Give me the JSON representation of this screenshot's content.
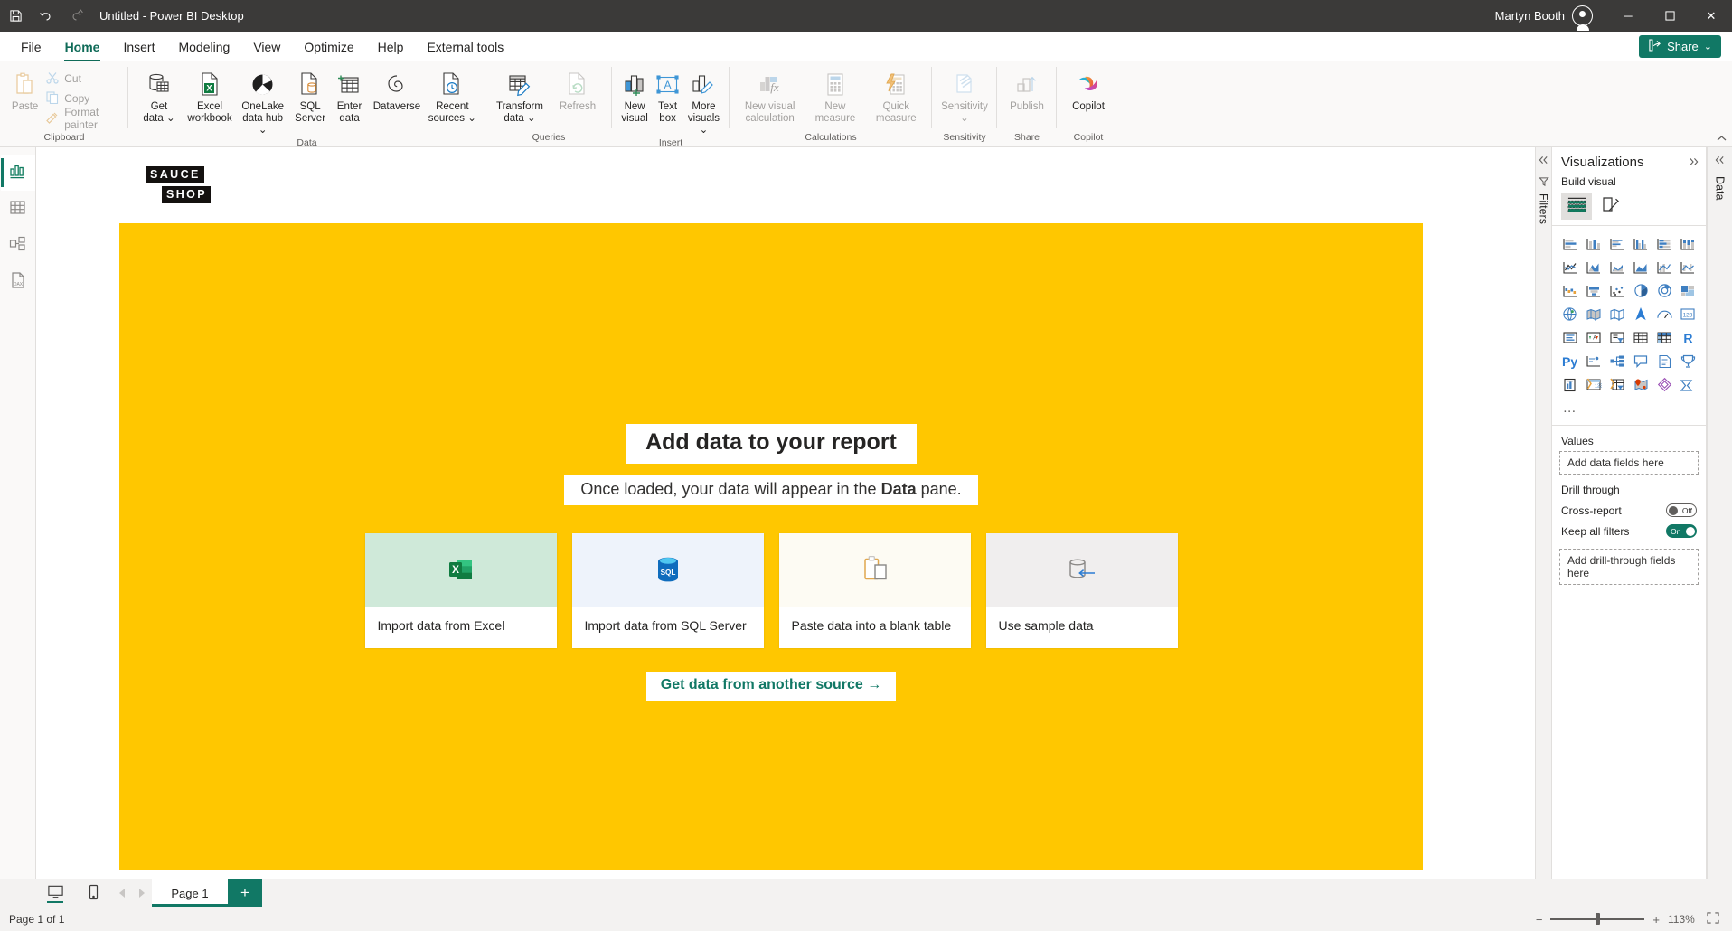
{
  "titlebar": {
    "save_icon": "save-icon",
    "undo_icon": "undo-icon",
    "redo_icon": "redo-icon",
    "title": "Untitled - Power BI Desktop",
    "user_name": "Martyn Booth",
    "avatar_icon": "account-avatar-icon",
    "minimize": "─",
    "maximize": "☐",
    "close": "✕"
  },
  "ribbon_tabs": [
    {
      "label": "File",
      "active": false
    },
    {
      "label": "Home",
      "active": true
    },
    {
      "label": "Insert",
      "active": false
    },
    {
      "label": "Modeling",
      "active": false
    },
    {
      "label": "View",
      "active": false
    },
    {
      "label": "Optimize",
      "active": false
    },
    {
      "label": "Help",
      "active": false
    },
    {
      "label": "External tools",
      "active": false
    }
  ],
  "share_button": {
    "label": "Share",
    "chevron": "⌄",
    "color": "#117865"
  },
  "ribbon": {
    "collapse_icon": "chevron-up-icon",
    "groups": [
      {
        "name": "clipboard",
        "label": "Clipboard",
        "paste": {
          "label": "Paste",
          "icon": "paste-icon",
          "disabled": true
        },
        "items": [
          {
            "label": "Cut",
            "icon": "scissors-icon",
            "disabled": true
          },
          {
            "label": "Copy",
            "icon": "copy-icon",
            "disabled": true
          },
          {
            "label": "Format painter",
            "icon": "format-painter-icon",
            "disabled": true
          }
        ]
      },
      {
        "name": "data",
        "label": "Data",
        "items": [
          {
            "label": "Get\ndata",
            "line1": "Get",
            "line2": "data ⌄",
            "icon": "get-data-icon",
            "disabled": false
          },
          {
            "label": "Excel workbook",
            "line1": "Excel",
            "line2": "workbook",
            "icon": "excel-icon",
            "disabled": false
          },
          {
            "label": "OneLake data hub",
            "line1": "OneLake",
            "line2": "data hub ⌄",
            "icon": "onelake-icon",
            "disabled": false
          },
          {
            "label": "SQL Server",
            "line1": "SQL",
            "line2": "Server",
            "icon": "sql-server-icon",
            "disabled": false
          },
          {
            "label": "Enter data",
            "line1": "Enter",
            "line2": "data",
            "icon": "enter-data-icon",
            "disabled": false
          },
          {
            "label": "Dataverse",
            "line1": "Dataverse",
            "line2": "",
            "icon": "dataverse-icon",
            "disabled": false
          },
          {
            "label": "Recent sources",
            "line1": "Recent",
            "line2": "sources ⌄",
            "icon": "recent-sources-icon",
            "disabled": false
          }
        ]
      },
      {
        "name": "queries",
        "label": "Queries",
        "items": [
          {
            "line1": "Transform",
            "line2": "data ⌄",
            "icon": "transform-data-icon",
            "disabled": false
          },
          {
            "line1": "Refresh",
            "line2": "",
            "icon": "refresh-icon",
            "disabled": true
          }
        ]
      },
      {
        "name": "insert",
        "label": "Insert",
        "items": [
          {
            "line1": "New",
            "line2": "visual",
            "icon": "new-visual-icon",
            "disabled": false
          },
          {
            "line1": "Text",
            "line2": "box",
            "icon": "text-box-icon",
            "disabled": false
          },
          {
            "line1": "More",
            "line2": "visuals ⌄",
            "icon": "more-visuals-icon",
            "disabled": false
          }
        ]
      },
      {
        "name": "calculations",
        "label": "Calculations",
        "items": [
          {
            "line1": "New visual",
            "line2": "calculation",
            "icon": "new-visual-calculation-icon",
            "disabled": true
          },
          {
            "line1": "New",
            "line2": "measure",
            "icon": "new-measure-icon",
            "disabled": true
          },
          {
            "line1": "Quick",
            "line2": "measure",
            "icon": "quick-measure-icon",
            "disabled": true
          }
        ]
      },
      {
        "name": "sensitivity",
        "label": "Sensitivity",
        "items": [
          {
            "line1": "Sensitivity",
            "line2": "⌄",
            "icon": "sensitivity-icon",
            "disabled": true
          }
        ]
      },
      {
        "name": "share",
        "label": "Share",
        "items": [
          {
            "line1": "Publish",
            "line2": "",
            "icon": "publish-icon",
            "disabled": true
          }
        ]
      },
      {
        "name": "copilot",
        "label": "Copilot",
        "items": [
          {
            "line1": "Copilot",
            "line2": "",
            "icon": "copilot-icon",
            "disabled": false
          }
        ]
      }
    ]
  },
  "left_rail": [
    {
      "name": "report-view",
      "icon": "report-bar-chart-icon",
      "active": true
    },
    {
      "name": "table-view",
      "icon": "table-grid-icon",
      "active": false
    },
    {
      "name": "model-view",
      "icon": "model-relationship-icon",
      "active": false
    },
    {
      "name": "dax-query-view",
      "icon": "dax-query-icon",
      "active": false
    }
  ],
  "canvas": {
    "logo": {
      "line1": "SAUCE",
      "line2": "SHOP"
    },
    "background_color": "#ffc700",
    "title": "Add data to your report",
    "subtitle_pre": "Once loaded, your data will appear in the ",
    "subtitle_bold": "Data",
    "subtitle_post": " pane.",
    "cards": [
      {
        "caption": "Import data from Excel",
        "icon": "excel-file-icon",
        "thumb_color": "#cfe9d9"
      },
      {
        "caption": "Import data from SQL Server",
        "icon": "sql-database-icon",
        "thumb_color": "#eef3fb"
      },
      {
        "caption": "Paste data into a blank table",
        "icon": "clipboard-paste-icon",
        "thumb_color": "#fdfbf3"
      },
      {
        "caption": "Use sample data",
        "icon": "sample-data-cylinder-icon",
        "thumb_color": "#f0eeee"
      }
    ],
    "more_link": "Get data from another source →"
  },
  "filters_rail": {
    "collapse_icon": "chevrons-left-icon",
    "filter_icon": "filter-icon",
    "label": "Filters"
  },
  "visualizations": {
    "title": "Visualizations",
    "expand_icon": "chevrons-right-icon",
    "section_label": "Build visual",
    "build_tabs": [
      {
        "name": "build-visual-tab",
        "icon": "fields-stack-icon",
        "selected": true
      },
      {
        "name": "format-visual-tab",
        "icon": "format-paint-page-icon",
        "selected": false
      }
    ],
    "gallery": [
      "stacked-bar-chart-icon",
      "stacked-column-chart-icon",
      "clustered-bar-chart-icon",
      "clustered-column-chart-icon",
      "100-stacked-bar-chart-icon",
      "100-stacked-column-chart-icon",
      "line-chart-icon",
      "area-chart-icon",
      "stacked-area-chart-icon",
      "line-stacked-column-icon",
      "line-clustered-column-icon",
      "ribbon-chart-icon",
      "waterfall-chart-icon",
      "funnel-chart-icon",
      "scatter-chart-icon",
      "pie-chart-icon",
      "donut-chart-icon",
      "treemap-icon",
      "map-icon",
      "filled-map-icon",
      "shape-map-icon",
      "azure-map-icon",
      "gauge-icon",
      "card-icon",
      "multi-row-card-icon",
      "kpi-icon",
      "slicer-icon",
      "table-icon",
      "matrix-icon",
      "r-script-visual-icon",
      "python-visual-icon",
      "key-influencers-icon",
      "decomposition-tree-icon",
      "qa-visual-icon",
      "narrative-icon",
      "metrics-icon",
      "paginated-report-icon",
      "power-apps-icon",
      "power-automate-icon",
      "arcgis-maps-icon",
      "azure-ml-icon",
      "smart-narrative-icon",
      "more-options-icon"
    ],
    "values_label": "Values",
    "values_placeholder": "Add data fields here",
    "drill_label": "Drill through",
    "cross_report": {
      "label": "Cross-report",
      "state": "Off",
      "on": false
    },
    "keep_all_filters": {
      "label": "Keep all filters",
      "state": "On",
      "on": true
    },
    "drill_placeholder": "Add drill-through fields here"
  },
  "data_rail": {
    "collapse_icon": "chevrons-left-icon",
    "label": "Data"
  },
  "pagebar": {
    "desktop_view_icon": "desktop-layout-icon",
    "mobile_view_icon": "mobile-layout-icon",
    "prev_icon": "◀",
    "next_icon": "▶",
    "tabs": [
      {
        "label": "Page 1",
        "selected": true
      }
    ],
    "add_label": "+"
  },
  "statusbar": {
    "page_status": "Page 1 of 1",
    "zoom_out": "−",
    "zoom_in": "+",
    "zoom_level": "113%",
    "fit_icon": "fit-to-page-icon"
  }
}
